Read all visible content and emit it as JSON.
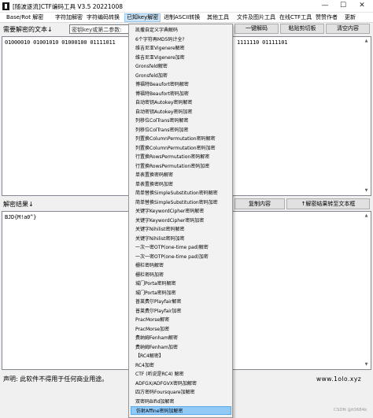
{
  "window": {
    "title": "[随波逐流]CTF编码工具 V3.5 20221008",
    "min": "—",
    "max": "☐",
    "close": "✕"
  },
  "menu": [
    "Base/Rot 解密",
    "字符加解密",
    "字符编码转换",
    "已知key解密",
    "进制ASCII转换",
    "其他工具",
    "文件及图片工具",
    "在线CTF工具",
    "赞赞作者",
    "更新"
  ],
  "input_section": {
    "label": "需要解密的文本↓",
    "key_placeholder": "密钥key或第二参数:",
    "decode_button": "一键解码",
    "paste_button": "粘贴剪切板",
    "clear_button": "清空内容",
    "text_left": "01000010 01001010 01000100 01111011",
    "text_right": "1111110 01111101"
  },
  "result_section": {
    "label": "解密结果↓",
    "copy_button": "复制内容",
    "move_button": "↑解密结果转至文本框",
    "text": "BJD{M!a0^}"
  },
  "footer": {
    "disclaimer": "声明: 此软件不得用于任何商业用途。",
    "site": "www.1olo.xyz"
  },
  "watermark": "CSDN @t0684k",
  "key_dropdown": [
    "凯撒自定义字典解码",
    "6个字符再MD5码计全?",
    "维吉尼亚Vigenere解密",
    "维吉尼亚Vigenere加密",
    "Gronsfeld解密",
    "Gronsfeld加密",
    "博福特Beaufort密码解密",
    "博福特Beaufort密码加密",
    "自动密钥Autokey密码解密",
    "自动密钥Autokey密码加密",
    "列移位ColTrans密码解密",
    "列移位ColTrans密码加密",
    "列置换ColumnPermutation密码解密",
    "列置换ColumnPermutation密码加密",
    "行置换RowsPermutation密码解密",
    "行置换RowsPermutation密码加密",
    "单表置换密码解密",
    "单表置换密码加密",
    "简单替换SimpleSubstitution密码解密",
    "简单替换SimpleSubstitution密码加密",
    "关键字KeywordCipher密码解密",
    "关键字KeywordCipher密码加密",
    "关键字Nihilist密码解密",
    "关键字Nihilist密码加密",
    "一次一密OTP(one-time pad)解密",
    "一次一密OTP(one-time pad)加密",
    "栅栏密码解密",
    "栅栏密码加密",
    "城门Porta密码解密",
    "城门Porta密码加密",
    "普莱费尔Playfair解密",
    "普莱费尔Playfair加密",
    "PracMorse解密",
    "PracMorse加密",
    "费纳姆Fenham解密",
    "费纳姆Fenham加密",
    "【RC4解密】",
    "RC4加密",
    "CTF (听说是RC4) 解密",
    "ADFGX/ADFGVX密码加解密",
    "四方密码Foursquare加解密",
    "双密码Bifid加解密",
    "仿射Affine密码加解密"
  ],
  "highlighted_index": 42
}
